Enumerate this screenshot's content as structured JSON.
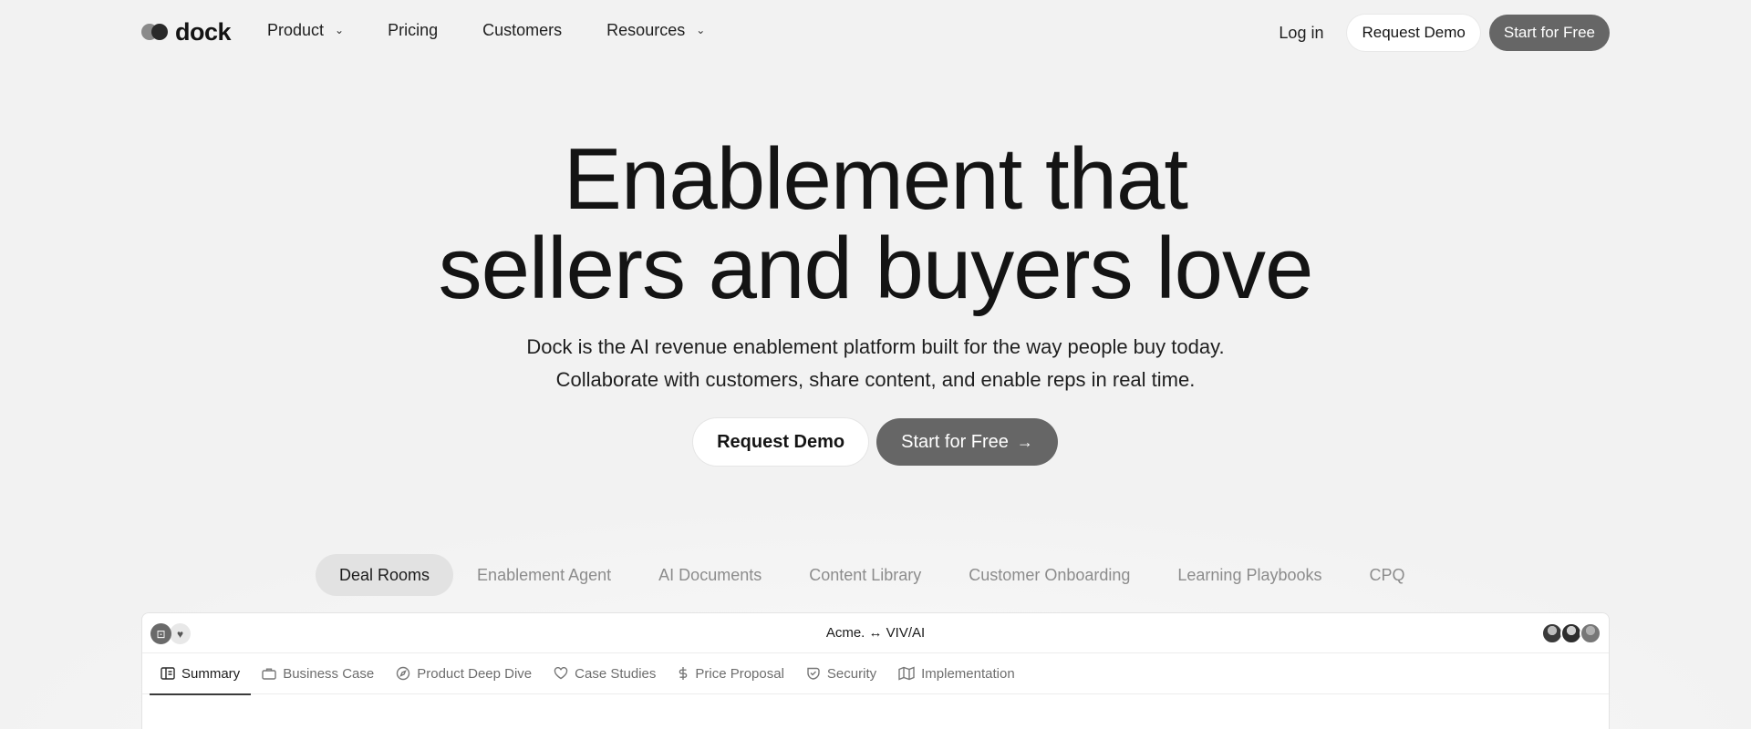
{
  "nav": {
    "logo_text": "dock",
    "links": [
      {
        "label": "Product",
        "has_dropdown": true
      },
      {
        "label": "Pricing",
        "has_dropdown": false
      },
      {
        "label": "Customers",
        "has_dropdown": false
      },
      {
        "label": "Resources",
        "has_dropdown": true
      }
    ],
    "login_label": "Log in",
    "request_demo_label": "Request Demo",
    "start_free_label": "Start for Free"
  },
  "hero": {
    "title_line1": "Enablement that",
    "title_line2": "sellers and buyers love",
    "subtitle_line1": "Dock is the AI revenue enablement platform built for the way people buy today.",
    "subtitle_line2": "Collaborate with customers, share content, and enable reps in real time.",
    "cta_secondary": "Request Demo",
    "cta_primary": "Start for Free",
    "cta_primary_icon": "arrow-right-icon"
  },
  "feature_tabs": [
    {
      "label": "Deal Rooms",
      "active": true
    },
    {
      "label": "Enablement Agent",
      "active": false
    },
    {
      "label": "AI Documents",
      "active": false
    },
    {
      "label": "Content Library",
      "active": false
    },
    {
      "label": "Customer Onboarding",
      "active": false
    },
    {
      "label": "Learning Playbooks",
      "active": false
    },
    {
      "label": "CPQ",
      "active": false
    }
  ],
  "preview": {
    "title": "Acme. ↔ VIV/AI",
    "tabs": [
      {
        "label": "Summary",
        "icon": "sidebar-layout-icon",
        "active": true
      },
      {
        "label": "Business Case",
        "icon": "briefcase-icon",
        "active": false
      },
      {
        "label": "Product Deep Dive",
        "icon": "compass-icon",
        "active": false
      },
      {
        "label": "Case Studies",
        "icon": "heart-icon",
        "active": false
      },
      {
        "label": "Price Proposal",
        "icon": "dollar-icon",
        "active": false
      },
      {
        "label": "Security",
        "icon": "shield-check-icon",
        "active": false
      },
      {
        "label": "Implementation",
        "icon": "map-icon",
        "active": false
      }
    ]
  },
  "colors": {
    "background": "#f2f2f2",
    "primary_button": "#666666",
    "text": "#141414",
    "muted_text": "#8c8c8c"
  }
}
